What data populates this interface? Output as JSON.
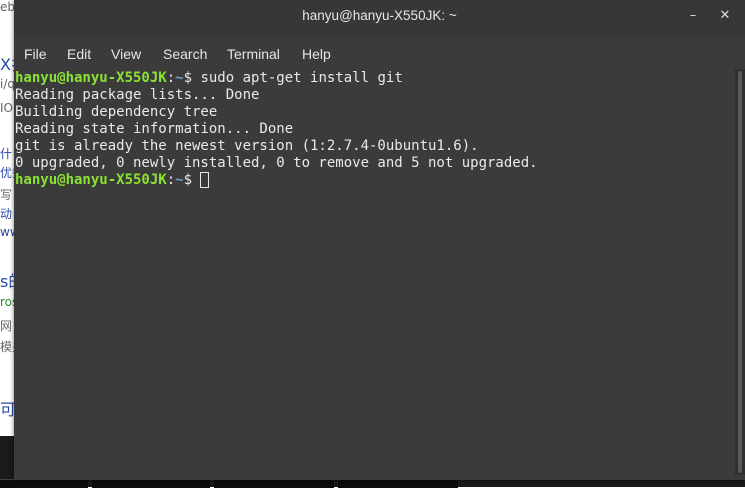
{
  "background": {
    "fragments": [
      {
        "text": "eb",
        "style": "gray"
      },
      {
        "text": "X扌",
        "style": "big"
      },
      {
        "text": "i/qu",
        "style": "gray"
      },
      {
        "text": "IO",
        "style": "gray"
      },
      {
        "text": "什",
        "style": ""
      },
      {
        "text": "优秀",
        "style": ""
      },
      {
        "text": "写",
        "style": "gray"
      },
      {
        "text": "动",
        "style": ""
      },
      {
        "text": "ww",
        "style": ""
      },
      {
        "text": "s的",
        "style": "big"
      },
      {
        "text": "ros",
        "style": "green"
      },
      {
        "text": "网",
        "style": "gray"
      },
      {
        "text": "模夬",
        "style": "gray"
      },
      {
        "text": "可 扌",
        "style": "big"
      }
    ]
  },
  "window": {
    "title": "hanyu@hanyu-X550JK: ~",
    "minimize_icon": "–",
    "close_icon": "✕"
  },
  "menu": {
    "items": [
      "File",
      "Edit",
      "View",
      "Search",
      "Terminal",
      "Help"
    ]
  },
  "terminal": {
    "prompt_user": "hanyu@hanyu-X550JK",
    "prompt_colon": ":",
    "prompt_path": "~",
    "prompt_symbol": "$ ",
    "command": "sudo apt-get install git",
    "output": [
      "Reading package lists... Done",
      "Building dependency tree",
      "Reading state information... Done",
      "git is already the newest version (1:2.7.4-0ubuntu1.6).",
      "0 upgraded, 0 newly installed, 0 to remove and 5 not upgraded."
    ]
  },
  "colors": {
    "terminal_bg": "#3b3b3b",
    "prompt_user": "#8ae234",
    "prompt_path": "#729fcf",
    "text": "#e9e9e9"
  }
}
